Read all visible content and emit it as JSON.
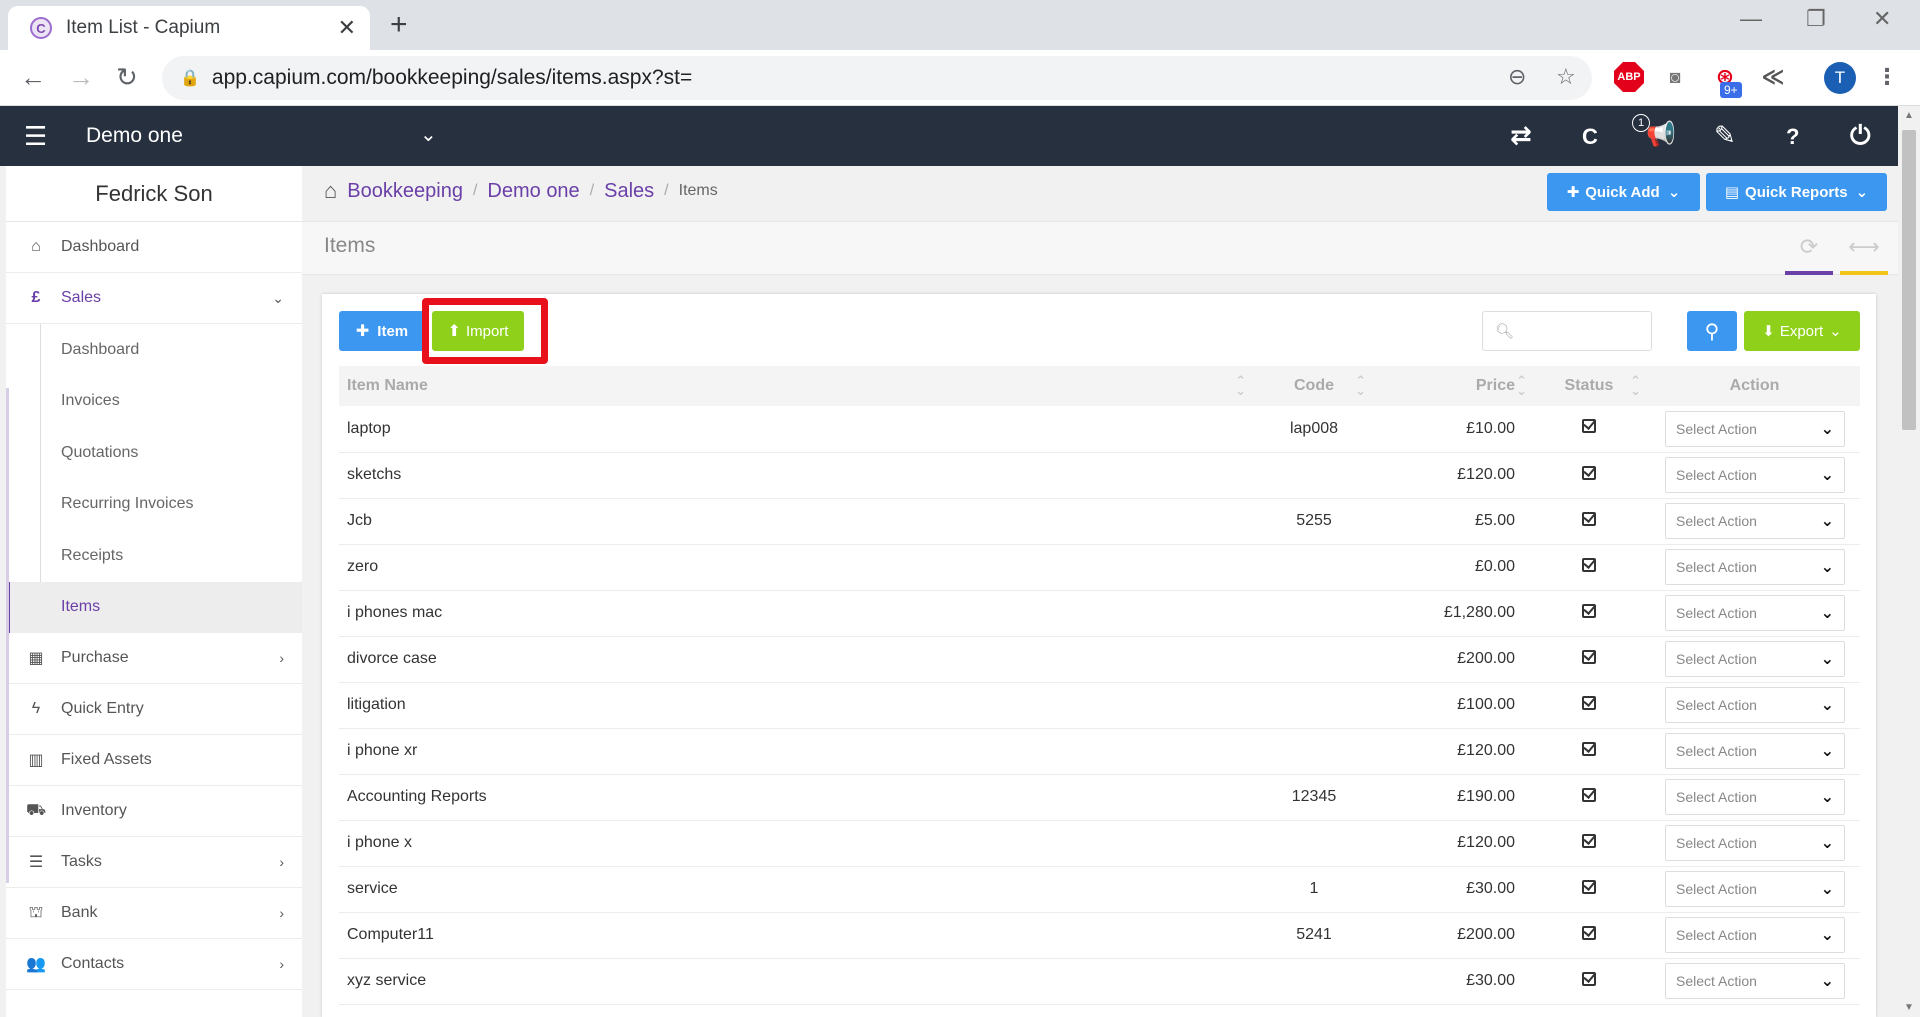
{
  "browser": {
    "tab_title": "Item List - Capium",
    "favicon_letter": "C",
    "url": "app.capium.com/bookkeeping/sales/items.aspx?st=",
    "extension_badge": "9+",
    "profile_initial": "T"
  },
  "appbar": {
    "company": "Demo one",
    "notification_count": "1",
    "brand_letter": "C",
    "help_label": "?"
  },
  "sidebar": {
    "user_name": "Fedrick Son",
    "items": [
      {
        "label": "Dashboard",
        "icon": "home-icon"
      },
      {
        "label": "Sales",
        "icon": "pound-icon"
      },
      {
        "label": "Purchase",
        "icon": "qr-icon"
      },
      {
        "label": "Quick Entry",
        "icon": "bolt-icon"
      },
      {
        "label": "Fixed Assets",
        "icon": "building-icon"
      },
      {
        "label": "Inventory",
        "icon": "truck-icon"
      },
      {
        "label": "Tasks",
        "icon": "tasks-icon"
      },
      {
        "label": "Bank",
        "icon": "bank-icon"
      },
      {
        "label": "Contacts",
        "icon": "users-icon"
      }
    ],
    "sales_sub": [
      "Dashboard",
      "Invoices",
      "Quotations",
      "Recurring Invoices",
      "Receipts",
      "Items"
    ]
  },
  "breadcrumb": {
    "items": [
      "Bookkeeping",
      "Demo one",
      "Sales"
    ],
    "current": "Items"
  },
  "quick": {
    "add": "Quick Add",
    "reports": "Quick Reports"
  },
  "page": {
    "title": "Items"
  },
  "toolbar": {
    "item_label": "Item",
    "import_label": "Import",
    "search_placeholder": "",
    "export_label": "Export"
  },
  "table": {
    "headers": [
      "Item Name",
      "Code",
      "Price",
      "Status",
      "Action"
    ],
    "action_placeholder": "Select Action",
    "rows": [
      {
        "name": "laptop",
        "code": "lap008",
        "price": "£10.00"
      },
      {
        "name": "sketchs",
        "code": "",
        "price": "£120.00"
      },
      {
        "name": "Jcb",
        "code": "5255",
        "price": "£5.00"
      },
      {
        "name": "zero",
        "code": "",
        "price": "£0.00"
      },
      {
        "name": "i phones mac",
        "code": "",
        "price": "£1,280.00"
      },
      {
        "name": "divorce case",
        "code": "",
        "price": "£200.00"
      },
      {
        "name": "litigation",
        "code": "",
        "price": "£100.00"
      },
      {
        "name": "i phone xr",
        "code": "",
        "price": "£120.00"
      },
      {
        "name": "Accounting Reports",
        "code": "12345",
        "price": "£190.00"
      },
      {
        "name": "i phone x",
        "code": "",
        "price": "£120.00"
      },
      {
        "name": "service",
        "code": "1",
        "price": "£30.00"
      },
      {
        "name": "Computer11",
        "code": "5241",
        "price": "£200.00"
      },
      {
        "name": "xyz service",
        "code": "",
        "price": "£30.00"
      }
    ]
  },
  "colors": {
    "primary_blue": "#3b97f0",
    "green": "#8fd11a",
    "purple": "#6a3fa8",
    "navbar": "#26303e",
    "highlight_red": "#e8101a"
  }
}
